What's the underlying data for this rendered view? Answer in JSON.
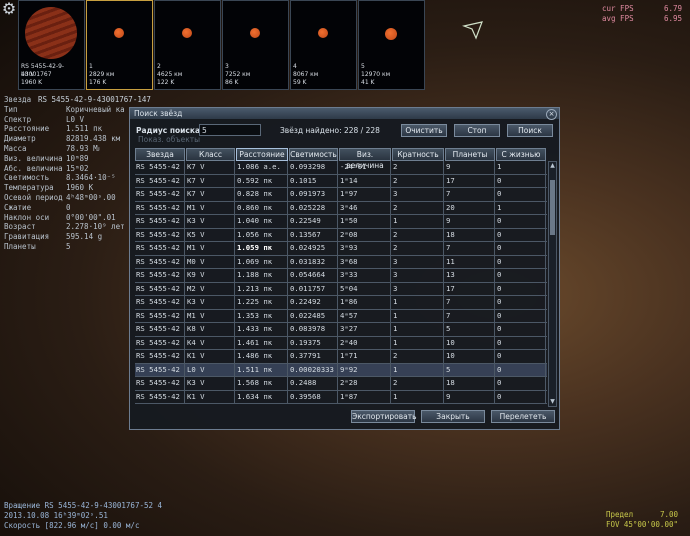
{
  "fps": {
    "cur_label": "cur FPS",
    "cur_value": "6.79",
    "avg_label": "avg FPS",
    "avg_value": "6.95"
  },
  "thumbnails": [
    {
      "num": "",
      "name": "RS 5455-42-9-43001767",
      "class": "L0 V",
      "temp": "1960 K",
      "dist": "",
      "color": "#8a3018"
    },
    {
      "num": "1",
      "name": "",
      "class": "",
      "dist": "2829 км",
      "temp": "176 K",
      "color": "#c04818"
    },
    {
      "num": "2",
      "name": "",
      "class": "",
      "dist": "4625 км",
      "temp": "122 K",
      "color": "#c04818"
    },
    {
      "num": "3",
      "name": "",
      "class": "",
      "dist": "7252 км",
      "temp": "86 K",
      "color": "#c04818"
    },
    {
      "num": "4",
      "name": "",
      "class": "",
      "dist": "8067 км",
      "temp": "59 K",
      "color": "#c04818"
    },
    {
      "num": "5",
      "name": "",
      "class": "",
      "dist": "12970 км",
      "temp": "41 K",
      "color": "#c04818"
    }
  ],
  "info": {
    "star_label": "Звезда",
    "star_name": "RS 5455-42-9-43001767-147",
    "rows": [
      {
        "k": "Тип",
        "v": "Коричневый ка"
      },
      {
        "k": "Спектр",
        "v": "L0 V"
      },
      {
        "k": "Расстояние",
        "v": "1.511 пк"
      },
      {
        "k": "Диаметр",
        "v": "82819.438 км"
      },
      {
        "k": "Масса",
        "v": "78.93 Mᴊ"
      },
      {
        "k": "Виз. величина",
        "v": "10ᵐ89"
      },
      {
        "k": "Абс. величина",
        "v": "15ᵐ02"
      },
      {
        "k": "Светимость",
        "v": "8.3464·10⁻⁵"
      },
      {
        "k": "Температура",
        "v": "1960 K"
      },
      {
        "k": "Осевой период",
        "v": "4ʰ48ᵐ00ˢ.00"
      },
      {
        "k": "Сжатие",
        "v": "0"
      },
      {
        "k": "Наклон оси",
        "v": "0°00'00\".01"
      },
      {
        "k": "Возраст",
        "v": "2.278·10⁹ лет"
      },
      {
        "k": "Гравитация",
        "v": "595.14 g"
      },
      {
        "k": "Планеты",
        "v": "5"
      }
    ]
  },
  "bottom": {
    "rotation": "Вращение  RS 5455-42-9-43001767-52 4",
    "date": "2013.10.08  16ʰ39ᵐ02ˢ.51",
    "speed": "Скорость [822.96 м/с] 0.00 м/с",
    "limit_label": "Предел",
    "limit_value": "7.00",
    "fov_label": "FOV",
    "fov_value": "45°00'00.00\""
  },
  "dialog": {
    "title": "Поиск звёзд",
    "radius_label": "Радиус поиска",
    "radius_value": "5",
    "show_objects": "Показ. объекты",
    "found_text": "Звёзд найдено: 228 / 228",
    "btn_clear": "Очистить",
    "btn_stop": "Стоп",
    "btn_search": "Поиск",
    "btn_export": "Экспортировать",
    "btn_close": "Закрыть",
    "btn_goto": "Перелететь",
    "columns": [
      "Звезда",
      "Класс",
      "Расстояние",
      "Светимость",
      "Виз. величина",
      "Кратность",
      "Планеты",
      "С жизнью"
    ],
    "rows": [
      [
        "RS 5455-42",
        "K7 V",
        "1.086 а.е.",
        "0.093298",
        "-24ᵐ01",
        "2",
        "9",
        "1"
      ],
      [
        "RS 5455-42",
        "K7 V",
        "0.592 пк",
        "0.1015",
        "1ᵐ14",
        "2",
        "17",
        "0"
      ],
      [
        "RS 5455-42",
        "K7 V",
        "0.828 пк",
        "0.091973",
        "1ᵐ97",
        "3",
        "7",
        "0"
      ],
      [
        "RS 5455-42",
        "M1 V",
        "0.860 пк",
        "0.025228",
        "3ᵐ46",
        "2",
        "20",
        "1"
      ],
      [
        "RS 5455-42",
        "K3 V",
        "1.040 пк",
        "0.22549",
        "1ᵐ50",
        "1",
        "9",
        "0"
      ],
      [
        "RS 5455-42",
        "K5 V",
        "1.056 пк",
        "0.13567",
        "2ᵐ08",
        "2",
        "18",
        "0"
      ],
      [
        "RS 5455-42",
        "M1 V",
        "1.059 пк",
        "0.024925",
        "3ᵐ93",
        "2",
        "7",
        "0"
      ],
      [
        "RS 5455-42",
        "M0 V",
        "1.069 пк",
        "0.031832",
        "3ᵐ68",
        "3",
        "11",
        "0"
      ],
      [
        "RS 5455-42",
        "K9 V",
        "1.188 пк",
        "0.054664",
        "3ᵐ33",
        "3",
        "13",
        "0"
      ],
      [
        "RS 5455-42",
        "M2 V",
        "1.213 пк",
        "0.011757",
        "5ᵐ04",
        "3",
        "17",
        "0"
      ],
      [
        "RS 5455-42",
        "K3 V",
        "1.225 пк",
        "0.22492",
        "1ᵐ86",
        "1",
        "7",
        "0"
      ],
      [
        "RS 5455-42",
        "M1 V",
        "1.353 пк",
        "0.022485",
        "4ᵐ57",
        "1",
        "7",
        "0"
      ],
      [
        "RS 5455-42",
        "K8 V",
        "1.433 пк",
        "0.083978",
        "3ᵐ27",
        "1",
        "5",
        "0"
      ],
      [
        "RS 5455-42",
        "K4 V",
        "1.461 пк",
        "0.19375",
        "2ᵐ40",
        "1",
        "10",
        "0"
      ],
      [
        "RS 5455-42",
        "K1 V",
        "1.486 пк",
        "0.37791",
        "1ᵐ71",
        "2",
        "10",
        "0"
      ],
      [
        "RS 5455-42",
        "L0 V",
        "1.511 пк",
        "0.00020333",
        "9ᵐ92",
        "1",
        "5",
        "0"
      ],
      [
        "RS 5455-42",
        "K3 V",
        "1.568 пк",
        "0.2488",
        "2ᵐ28",
        "2",
        "18",
        "0"
      ],
      [
        "RS 5455-42",
        "K1 V",
        "1.634 пк",
        "0.39568",
        "1ᵐ87",
        "1",
        "9",
        "0"
      ]
    ],
    "selected_row": 15,
    "bold_rows": [
      6
    ],
    "scroll_position_percent": 6
  }
}
